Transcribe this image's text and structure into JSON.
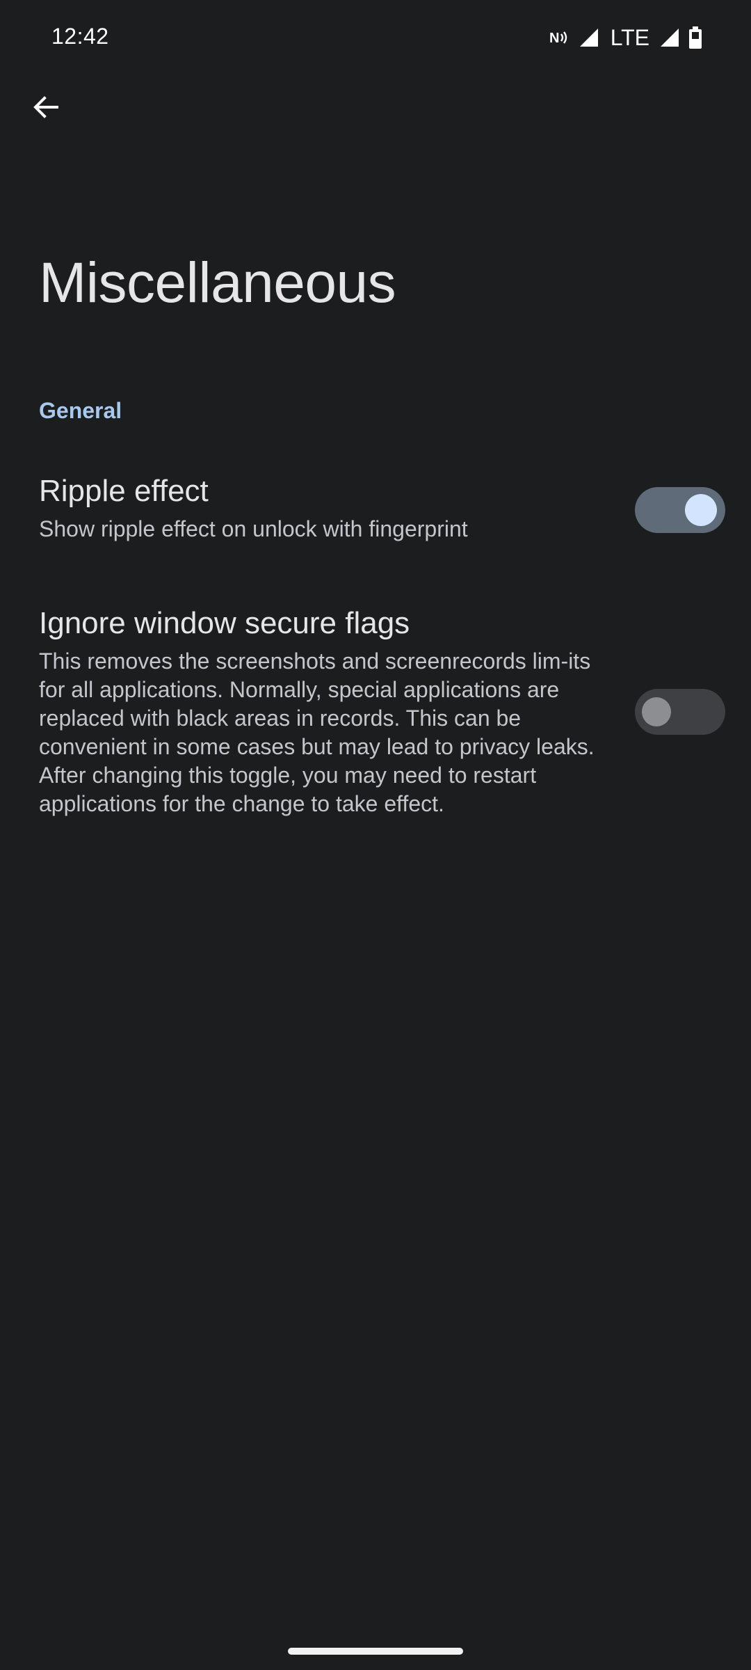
{
  "status_bar": {
    "time": "12:42",
    "network_label": "LTE",
    "icons": [
      "nfc-icon",
      "signal-icon",
      "signal-icon",
      "battery-icon"
    ]
  },
  "toolbar": {
    "back_icon": "arrow-back-icon"
  },
  "page": {
    "title": "Miscellaneous"
  },
  "sections": [
    {
      "header": "General",
      "items": [
        {
          "title": "Ripple effect",
          "summary": "Show ripple effect on unlock with fingerprint",
          "enabled": true
        },
        {
          "title": "Ignore window secure flags",
          "summary": "This removes the screenshots and screenrecords lim-its for all applications. Normally, special applications are replaced with black areas in records. This can be convenient in some cases but may lead to privacy leaks. After changing this toggle, you may need to restart applications for the change to take effect.",
          "enabled": false
        }
      ]
    }
  ],
  "colors": {
    "background": "#1c1d1f",
    "accent": "#a8c8ee",
    "switch_on_track": "#5f6b78",
    "switch_on_thumb": "#d3e4ff",
    "switch_off_track": "#3f4043",
    "switch_off_thumb": "#8d8e91"
  }
}
